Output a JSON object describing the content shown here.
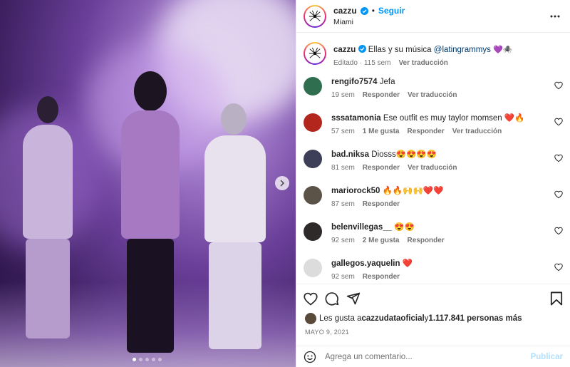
{
  "post": {
    "username": "cazzu",
    "follow_label": "Seguir",
    "location": "Miami",
    "dot": "•"
  },
  "caption": {
    "username": "cazzu",
    "text_before": "Ellas y su música ",
    "mention": "@latingrammys",
    "emoji": "💜🕷️",
    "edited": "Editado",
    "time": "115 sem",
    "translate": "Ver traducción"
  },
  "comments": [
    {
      "user": "rengifo7574",
      "text": "Jefa",
      "time": "19 sem",
      "likes": "",
      "reply": "Responder",
      "translate": "Ver traducción",
      "avatar_color": "#2f6e4e"
    },
    {
      "user": "sssatamonia",
      "text": "Ese outfit es muy taylor momsen ❤️🔥",
      "time": "57 sem",
      "likes": "1 Me gusta",
      "reply": "Responder",
      "translate": "Ver traducción",
      "avatar_color": "#b3261e"
    },
    {
      "user": "bad.niksa",
      "text": "Diosss😍😍😍😍",
      "time": "81 sem",
      "likes": "",
      "reply": "Responder",
      "translate": "Ver traducción",
      "avatar_color": "#3c3f57"
    },
    {
      "user": "mariorock50",
      "text": "🔥🔥🙌🙌❤️❤️",
      "time": "87 sem",
      "likes": "",
      "reply": "Responder",
      "translate": "",
      "avatar_color": "#5b5347"
    },
    {
      "user": "belenvillegas__",
      "text": "😍😍",
      "time": "92 sem",
      "likes": "2 Me gusta",
      "reply": "Responder",
      "translate": "",
      "avatar_color": "#2e2a2a"
    },
    {
      "user": "gallegos.yaquelin",
      "text": "❤️",
      "time": "92 sem",
      "likes": "",
      "reply": "Responder",
      "translate": "",
      "avatar_color": "#dcdcdc"
    }
  ],
  "likes": {
    "prefix": "Les gusta a ",
    "user": "cazzudataoficial",
    "middle": " y ",
    "count": "1.117.841 personas más"
  },
  "date": "MAYO 9, 2021",
  "add_comment": {
    "placeholder": "Agrega un comentario...",
    "post_label": "Publicar"
  },
  "carousel": {
    "slides": 5,
    "active_index": 0
  },
  "colors": {
    "accent": "#0095f6",
    "muted": "#737373",
    "link": "#00376b"
  }
}
